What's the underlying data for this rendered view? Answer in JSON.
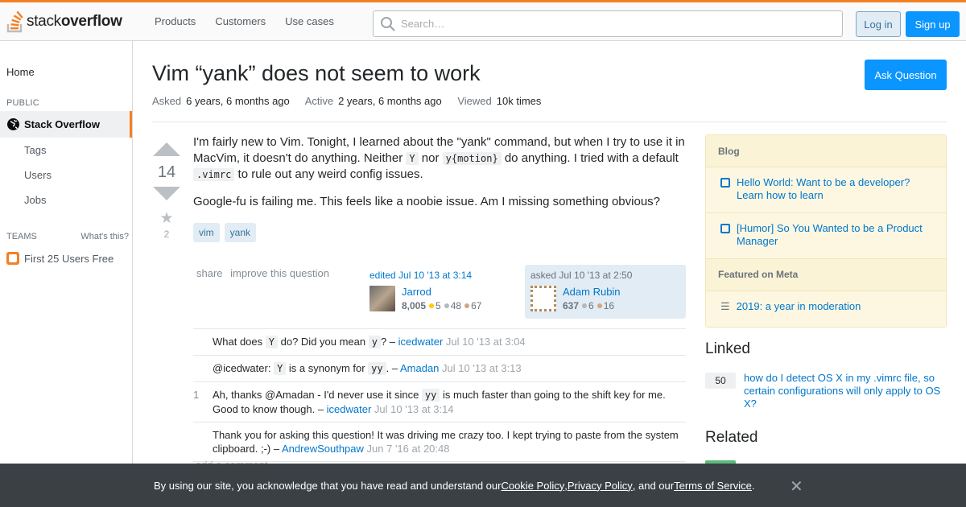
{
  "header": {
    "logo_brand_plain": "stack",
    "logo_brand_bold": "overflow",
    "nav": [
      "Products",
      "Customers",
      "Use cases"
    ],
    "search_placeholder": "Search…",
    "login": "Log in",
    "signup": "Sign up"
  },
  "sidebar": {
    "home": "Home",
    "public_label": "PUBLIC",
    "stack_overflow": "Stack Overflow",
    "tags": "Tags",
    "users": "Users",
    "jobs": "Jobs",
    "teams_label": "TEAMS",
    "whats_this": "What's this?",
    "first_free": "First 25 Users Free"
  },
  "question": {
    "title": "Vim “yank” does not seem to work",
    "ask_button": "Ask Question",
    "asked_label": "Asked",
    "asked_value": "6 years, 6 months ago",
    "active_label": "Active",
    "active_value": "2 years, 6 months ago",
    "viewed_label": "Viewed",
    "viewed_value": "10k times",
    "votes": "14",
    "favorites": "2",
    "body_p1_a": "I'm fairly new to Vim. Tonight, I learned about the \"yank\" command, but when I try to use it in MacVim, it doesn't do anything. Neither ",
    "body_p1_code1": "Y",
    "body_p1_b": " nor ",
    "body_p1_code2": "y{motion}",
    "body_p1_c": " do anything. I tried with a default ",
    "body_p1_code3": ".vimrc",
    "body_p1_d": " to rule out any weird config issues.",
    "body_p2": "Google-fu is failing me. This feels like a noobie issue. Am I missing something obvious?",
    "tags": [
      "vim",
      "yank"
    ],
    "share": "share",
    "improve": "improve this question",
    "edited_label": "edited Jul 10 '13 at 3:14",
    "editor_name": "Jarrod",
    "editor_rep": "8,005",
    "editor_gold": "5",
    "editor_silver": "48",
    "editor_bronze": "67",
    "asked_card_label": "asked Jul 10 '13 at 2:50",
    "asker_name": "Adam Rubin",
    "asker_rep": "637",
    "asker_silver": "6",
    "asker_bronze": "16"
  },
  "comments": [
    {
      "score": "",
      "t1": "What does ",
      "c1": "Y",
      "t2": " do? Did you mean ",
      "c2": "y",
      "t3": "? – ",
      "user": "icedwater",
      "date": "Jul 10 '13 at 3:04"
    },
    {
      "score": "",
      "t1": "@icedwater: ",
      "c1": "Y",
      "t2": " is a synonym for ",
      "c2": "yy",
      "t3": ". – ",
      "user": "Amadan",
      "date": "Jul 10 '13 at 3:13"
    },
    {
      "score": "1",
      "t1": "Ah, thanks @Amadan - I'd never use it since ",
      "c1": "yy",
      "t2": " is much faster than going to the shift key for me. Good to know though. – ",
      "user": "icedwater",
      "date": "Jul 10 '13 at 3:14"
    },
    {
      "score": "",
      "t1": "Thank you for asking this question! It was driving me crazy too. I kept trying to paste from the system clipboard. ;-) – ",
      "user": "AndrewSouthpaw",
      "date": "Jun 7 '16 at 20:48"
    }
  ],
  "add_comment": "add a comment",
  "blog": {
    "header": "Blog",
    "items": [
      "Hello World: Want to be a developer? Learn how to learn",
      "[Humor] So You Wanted to be a Product Manager"
    ],
    "meta_header": "Featured on Meta",
    "meta_item": "2019: a year in moderation"
  },
  "linked": {
    "heading": "Linked",
    "count": "50",
    "text": "how do I detect OS X in my .vimrc file, so certain configurations will only apply to OS X?"
  },
  "related_heading": "Related",
  "cookie": {
    "pre": "By using our site, you acknowledge that you have read and understand our ",
    "cookie_policy": "Cookie Policy",
    "sep1": ", ",
    "privacy_policy": "Privacy Policy",
    "sep2": ", and our ",
    "terms": "Terms of Service",
    "end": "."
  },
  "colors": {
    "accent": "#f48024",
    "primary": "#0a95ff",
    "link": "#0077cc"
  }
}
